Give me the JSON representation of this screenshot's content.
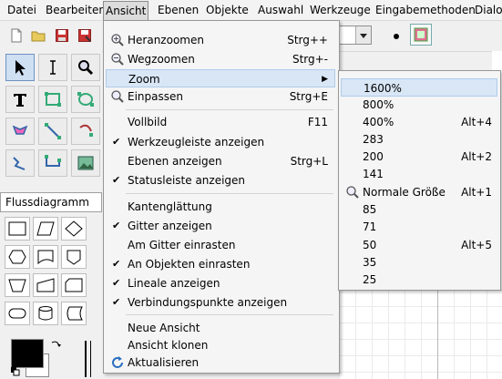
{
  "menubar": {
    "items": [
      "Datei",
      "Bearbeiten",
      "Ansicht",
      "Ebenen",
      "Objekte",
      "Auswahl",
      "Werkzeuge",
      "Eingabemethoden",
      "Dialo"
    ],
    "active": "Ansicht"
  },
  "toolbox": {
    "sheet_selected": "Flussdiagramm"
  },
  "ansicht_menu": {
    "zoom_in": "Heranzoomen",
    "zoom_in_acc": "Strg++",
    "zoom_out": "Wegzoomen",
    "zoom_out_acc": "Strg+-",
    "zoom": "Zoom",
    "fit": "Einpassen",
    "fit_acc": "Strg+E",
    "fullscreen": "Vollbild",
    "fullscreen_acc": "F11",
    "show_toolbar": "Werkzeugleiste anzeigen",
    "show_layers": "Ebenen anzeigen",
    "show_layers_acc": "Strg+L",
    "show_statusbar": "Statusleiste anzeigen",
    "antialias": "Kantenglättung",
    "show_grid": "Gitter anzeigen",
    "snap_grid": "Am Gitter einrasten",
    "snap_objects": "An Objekten einrasten",
    "show_rulers": "Lineale anzeigen",
    "show_connpoints": "Verbindungspunkte anzeigen",
    "new_view": "Neue Ansicht",
    "clone_view": "Ansicht klonen",
    "refresh": "Aktualisieren"
  },
  "zoom_menu": {
    "items": [
      {
        "label": "1600%",
        "acc": ""
      },
      {
        "label": "800%",
        "acc": ""
      },
      {
        "label": "400%",
        "acc": "Alt+4"
      },
      {
        "label": "283",
        "acc": ""
      },
      {
        "label": "200",
        "acc": "Alt+2"
      },
      {
        "label": "141",
        "acc": ""
      },
      {
        "label": "Normale Größe",
        "acc": "Alt+1"
      },
      {
        "label": "85",
        "acc": ""
      },
      {
        "label": "71",
        "acc": ""
      },
      {
        "label": "50",
        "acc": "Alt+5"
      },
      {
        "label": "35",
        "acc": ""
      },
      {
        "label": "25",
        "acc": ""
      }
    ]
  },
  "icons": {
    "zoom_in": "magnifier-plus-icon",
    "zoom_out": "magnifier-minus-icon",
    "refresh": "refresh-icon",
    "normal_size": "magnifier-icon"
  }
}
